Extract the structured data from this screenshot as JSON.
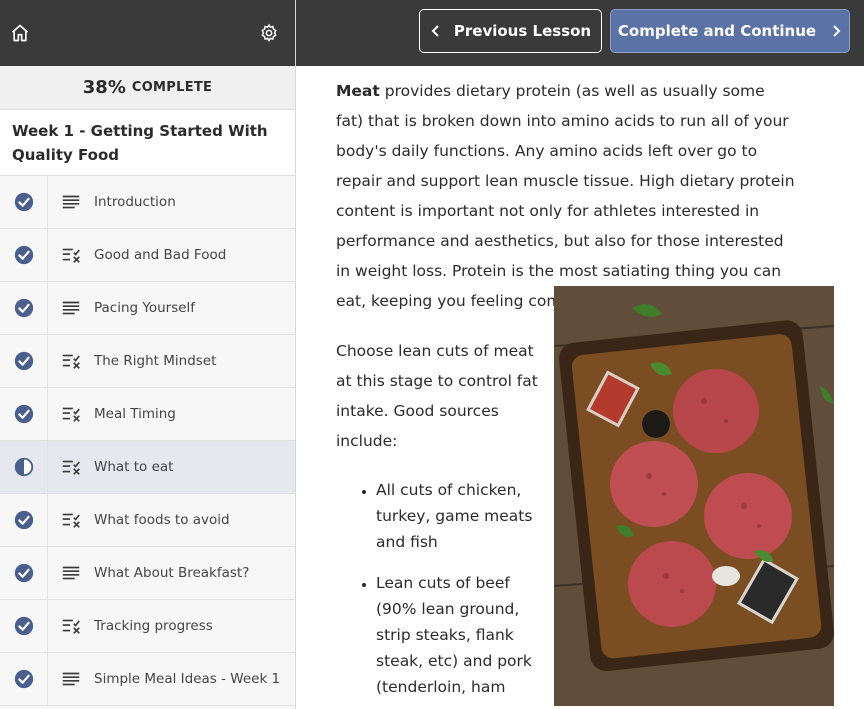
{
  "sidebar": {
    "progress": {
      "percent": "38%",
      "label": "COMPLETE",
      "value": 0.38
    },
    "section_title": "Week 1 - Getting Started With Quality Food",
    "lessons": [
      {
        "title": "Introduction",
        "status": "complete",
        "type": "text"
      },
      {
        "title": "Good and Bad Food",
        "status": "complete",
        "type": "quiz"
      },
      {
        "title": "Pacing Yourself",
        "status": "complete",
        "type": "text"
      },
      {
        "title": "The Right Mindset",
        "status": "complete",
        "type": "quiz"
      },
      {
        "title": "Meal Timing",
        "status": "complete",
        "type": "quiz"
      },
      {
        "title": "What to eat",
        "status": "in-progress",
        "type": "quiz"
      },
      {
        "title": "What foods to avoid",
        "status": "complete",
        "type": "quiz"
      },
      {
        "title": "What About Breakfast?",
        "status": "complete",
        "type": "text"
      },
      {
        "title": "Tracking progress",
        "status": "complete",
        "type": "quiz"
      },
      {
        "title": "Simple Meal Ideas - Week 1",
        "status": "complete",
        "type": "text"
      }
    ]
  },
  "header": {
    "prev_label": "Previous Lesson",
    "next_label": "Complete and Continue"
  },
  "article": {
    "intro_bold": "Meat",
    "intro_text": " provides dietary protein (as well as usually some fat) that is broken down into amino acids to run all of your body's daily functions. Any amino acids left over go to repair and support lean muscle tissue. High dietary protein content is important not only for athletes interested in performance and aesthetics, but also for those interested in weight loss. Protein is the most satiating thing you can eat, keeping you feeling comfortably full for longer.",
    "paragraph2": "Choose lean cuts of meat at this stage to control fat intake. Good sources include:",
    "bullets": [
      "All cuts of chicken, turkey, game meats and fish",
      "Lean cuts of beef (90% lean ground, strip steaks, flank steak, etc) and pork (tenderloin, ham"
    ]
  },
  "icons": {
    "home": "home-icon",
    "settings": "gear-icon",
    "complete": "check-circle-icon",
    "in_progress": "half-circle-icon",
    "text_lesson": "text-lines-icon",
    "quiz_lesson": "quiz-checklist-icon"
  },
  "colors": {
    "accent": "#5a72a6",
    "header_bg": "#3a3a3a",
    "check": "#4a5f8e",
    "current_row": "#e6e8f0"
  }
}
